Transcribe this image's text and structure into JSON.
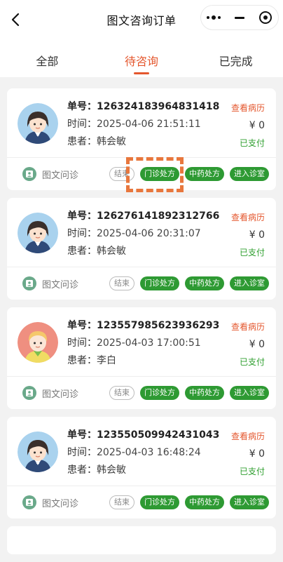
{
  "navbar": {
    "title": "图文咨询订单"
  },
  "tabs": [
    {
      "label": "全部"
    },
    {
      "label": "待咨询"
    },
    {
      "label": "已完成"
    }
  ],
  "colors": {
    "accent": "#e4572e",
    "green": "#2e9a33",
    "paid": "#2f9f2f"
  },
  "labels": {
    "order": "单号：",
    "time": "时间：",
    "patient": "患者："
  },
  "orders": [
    {
      "order_no": "126324183964831418",
      "time": "2025-04-06 21:51:11",
      "patient": "韩会敏",
      "link": "查看病历",
      "price": "¥ 0",
      "status": "已支付",
      "type": "图文问诊",
      "avatar": "female-avatar-icon",
      "btn_end": "结束",
      "btn_clinic": "门诊处方",
      "btn_herbal": "中药处方",
      "btn_enter": "进入诊室"
    },
    {
      "order_no": "126276141892312766",
      "time": "2025-04-06 20:31:07",
      "patient": "韩会敏",
      "link": "查看病历",
      "price": "¥ 0",
      "status": "已支付",
      "type": "图文问诊",
      "avatar": "female-avatar-icon",
      "btn_end": "结束",
      "btn_clinic": "门诊处方",
      "btn_herbal": "中药处方",
      "btn_enter": "进入诊室"
    },
    {
      "order_no": "123557985623936293",
      "time": "2025-04-03 17:00:51",
      "patient": "李白",
      "link": "查看病历",
      "price": "¥ 0",
      "status": "已支付",
      "type": "图文问诊",
      "avatar": "male-avatar-icon",
      "btn_end": "结束",
      "btn_clinic": "门诊处方",
      "btn_herbal": "中药处方",
      "btn_enter": "进入诊室"
    },
    {
      "order_no": "123550509942431043",
      "time": "2025-04-03 16:48:24",
      "patient": "韩会敏",
      "link": "查看病历",
      "price": "¥ 0",
      "status": "已支付",
      "type": "图文问诊",
      "avatar": "female-avatar-icon",
      "btn_end": "结束",
      "btn_clinic": "门诊处方",
      "btn_herbal": "中药处方",
      "btn_enter": "进入诊室"
    }
  ]
}
